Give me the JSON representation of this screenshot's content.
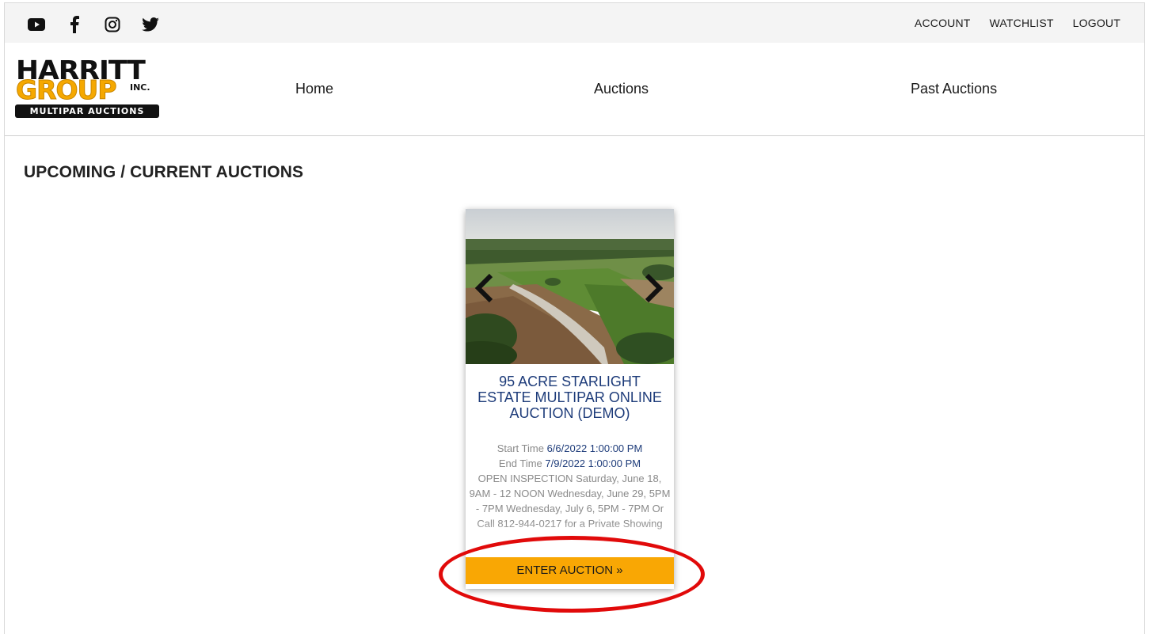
{
  "topbar": {
    "social_icons": [
      "youtube-icon",
      "facebook-icon",
      "instagram-icon",
      "twitter-icon"
    ],
    "links": [
      "ACCOUNT",
      "WATCHLIST",
      "LOGOUT"
    ]
  },
  "logo": {
    "line1": "HARRITT",
    "line2": "GROUP",
    "inc": "INC.",
    "line3": "MULTIPAR AUCTIONS"
  },
  "nav": {
    "home": "Home",
    "auctions": "Auctions",
    "past": "Past Auctions"
  },
  "page": {
    "title": "UPCOMING / CURRENT AUCTIONS"
  },
  "card": {
    "title": "95 ACRE STARLIGHT ESTATE MULTIPAR ONLINE AUCTION (DEMO)",
    "start_label": "Start Time",
    "start_value": "6/6/2022 1:00:00 PM",
    "end_label": "End Time",
    "end_value": "7/9/2022 1:00:00 PM",
    "description": "OPEN INSPECTION Saturday, June 18, 9AM - 12 NOON Wednesday, June 29, 5PM - 7PM Wednesday, July 6, 5PM - 7PM Or Call 812-944-0217 for a Private Showing",
    "button": "ENTER AUCTION »"
  },
  "colors": {
    "accent": "#f9a704",
    "title_blue": "#1e3c7a",
    "annotation_red": "#e10a0a"
  }
}
